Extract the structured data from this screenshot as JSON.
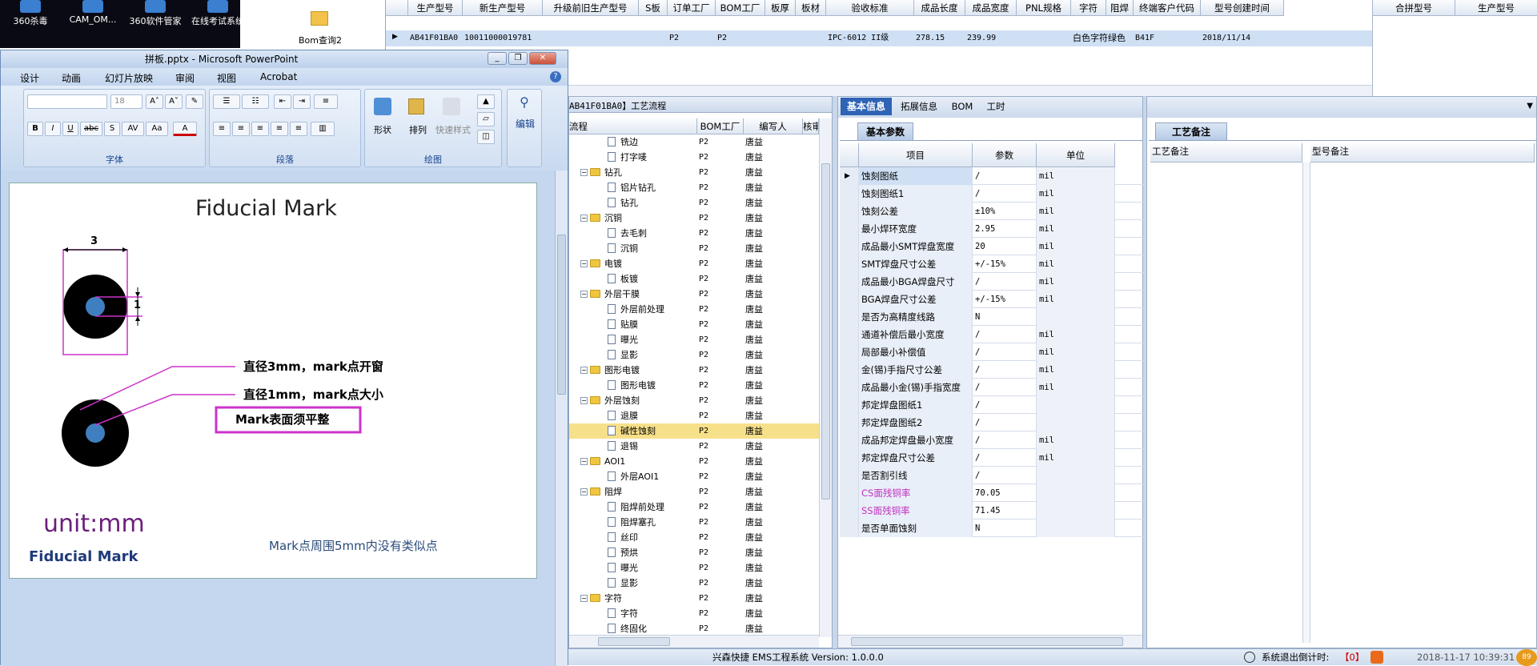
{
  "desktop": {
    "icons": [
      {
        "label": "360杀毒",
        "icon": "antivirus-icon"
      },
      {
        "label": "CAM_OM...",
        "icon": "cam-app-icon"
      },
      {
        "label": "360软件管家",
        "icon": "software-manager-icon"
      },
      {
        "label": "在线考试系统",
        "icon": "exam-system-icon"
      }
    ],
    "folder_label": "Bom查询2"
  },
  "top_grid": {
    "columns": [
      "生产型号",
      "新生产型号",
      "升级前旧生产型号",
      "S板",
      "订单工厂",
      "BOM工厂",
      "板厚",
      "板材",
      "验收标准",
      "成品长度",
      "成品宽度",
      "PNL规格",
      "字符",
      "阻焊",
      "终端客户代码",
      "型号创建时间"
    ],
    "row": [
      "AB41F01BA0",
      "10011000019781",
      "",
      "",
      "P2",
      "P2",
      "",
      "",
      "IPC-6012 II级",
      "278.15",
      "239.99",
      "",
      "白色字符",
      "绿色",
      "B41F",
      "2018/11/14"
    ],
    "right_columns": [
      "合拼型号",
      "生产型号"
    ]
  },
  "ppt": {
    "title": "拼板.pptx - Microsoft PowerPoint",
    "tabs": [
      "设计",
      "动画",
      "幻灯片放映",
      "审阅",
      "视图",
      "Acrobat"
    ],
    "font_size": "18",
    "groups": {
      "font": "字体",
      "paragraph": "段落",
      "drawing": "绘图"
    },
    "drawing_buttons": {
      "shape": "形状",
      "arrange": "排列",
      "quick_style": "快速样式",
      "edit": "编辑"
    },
    "slide": {
      "title": "Fiducial Mark",
      "dim_outer": "3",
      "dim_inner": "1",
      "note1": "直径3mm，mark点开窗",
      "note2": "直径1mm，mark点大小",
      "note3": "Mark表面须平整",
      "unit": "unit:mm",
      "footer_left": "Fiducial Mark",
      "footer_note": "Mark点周围5mm内没有类似点"
    }
  },
  "tree": {
    "header_title": "AB41F01BA0】工艺流程",
    "columns": [
      "流程",
      "BOM工厂",
      "编写人",
      "核审"
    ],
    "rows": [
      {
        "label": "铣边",
        "level": 2,
        "folder": false,
        "factory": "P2",
        "author": "唐益"
      },
      {
        "label": "打字唛",
        "level": 2,
        "folder": false,
        "factory": "P2",
        "author": "唐益"
      },
      {
        "label": "钻孔",
        "level": 1,
        "folder": true,
        "factory": "P2",
        "author": "唐益"
      },
      {
        "label": "铝片钻孔",
        "level": 2,
        "folder": false,
        "factory": "P2",
        "author": "唐益"
      },
      {
        "label": "钻孔",
        "level": 2,
        "folder": false,
        "factory": "P2",
        "author": "唐益"
      },
      {
        "label": "沉铜",
        "level": 1,
        "folder": true,
        "factory": "P2",
        "author": "唐益"
      },
      {
        "label": "去毛刺",
        "level": 2,
        "folder": false,
        "factory": "P2",
        "author": "唐益"
      },
      {
        "label": "沉铜",
        "level": 2,
        "folder": false,
        "factory": "P2",
        "author": "唐益"
      },
      {
        "label": "电镀",
        "level": 1,
        "folder": true,
        "factory": "P2",
        "author": "唐益"
      },
      {
        "label": "板镀",
        "level": 2,
        "folder": false,
        "factory": "P2",
        "author": "唐益"
      },
      {
        "label": "外层干膜",
        "level": 1,
        "folder": true,
        "factory": "P2",
        "author": "唐益"
      },
      {
        "label": "外层前处理",
        "level": 2,
        "folder": false,
        "factory": "P2",
        "author": "唐益"
      },
      {
        "label": "贴膜",
        "level": 2,
        "folder": false,
        "factory": "P2",
        "author": "唐益"
      },
      {
        "label": "曝光",
        "level": 2,
        "folder": false,
        "factory": "P2",
        "author": "唐益"
      },
      {
        "label": "显影",
        "level": 2,
        "folder": false,
        "factory": "P2",
        "author": "唐益"
      },
      {
        "label": "图形电镀",
        "level": 1,
        "folder": true,
        "factory": "P2",
        "author": "唐益"
      },
      {
        "label": "图形电镀",
        "level": 2,
        "folder": false,
        "factory": "P2",
        "author": "唐益"
      },
      {
        "label": "外层蚀刻",
        "level": 1,
        "folder": true,
        "factory": "P2",
        "author": "唐益"
      },
      {
        "label": "退膜",
        "level": 2,
        "folder": false,
        "factory": "P2",
        "author": "唐益"
      },
      {
        "label": "碱性蚀刻",
        "level": 2,
        "folder": false,
        "factory": "P2",
        "author": "唐益",
        "selected": true
      },
      {
        "label": "退锡",
        "level": 2,
        "folder": false,
        "factory": "P2",
        "author": "唐益"
      },
      {
        "label": "AOI1",
        "level": 1,
        "folder": true,
        "factory": "P2",
        "author": "唐益"
      },
      {
        "label": "外层AOI1",
        "level": 2,
        "folder": false,
        "factory": "P2",
        "author": "唐益"
      },
      {
        "label": "阻焊",
        "level": 1,
        "folder": true,
        "factory": "P2",
        "author": "唐益"
      },
      {
        "label": "阻焊前处理",
        "level": 2,
        "folder": false,
        "factory": "P2",
        "author": "唐益"
      },
      {
        "label": "阻焊塞孔",
        "level": 2,
        "folder": false,
        "factory": "P2",
        "author": "唐益"
      },
      {
        "label": "丝印",
        "level": 2,
        "folder": false,
        "factory": "P2",
        "author": "唐益"
      },
      {
        "label": "预烘",
        "level": 2,
        "folder": false,
        "factory": "P2",
        "author": "唐益"
      },
      {
        "label": "曝光",
        "level": 2,
        "folder": false,
        "factory": "P2",
        "author": "唐益"
      },
      {
        "label": "显影",
        "level": 2,
        "folder": false,
        "factory": "P2",
        "author": "唐益"
      },
      {
        "label": "字符",
        "level": 1,
        "folder": true,
        "factory": "P2",
        "author": "唐益"
      },
      {
        "label": "字符",
        "level": 2,
        "folder": false,
        "factory": "P2",
        "author": "唐益"
      },
      {
        "label": "终固化",
        "level": 2,
        "folder": false,
        "factory": "P2",
        "author": "唐益"
      }
    ]
  },
  "props": {
    "tabs": [
      "基本信息",
      "拓展信息",
      "BOM",
      "工时"
    ],
    "sub_tab": "基本参数",
    "columns": [
      "项目",
      "参数",
      "单位"
    ],
    "rows": [
      {
        "item": "蚀刻图纸",
        "value": "/",
        "unit": "mil"
      },
      {
        "item": "蚀刻图纸1",
        "value": "/",
        "unit": "mil"
      },
      {
        "item": "蚀刻公差",
        "value": "±10%",
        "unit": "mil"
      },
      {
        "item": "最小焊环宽度",
        "value": "2.95",
        "unit": "mil"
      },
      {
        "item": "成品最小SMT焊盘宽度",
        "value": "20",
        "unit": "mil"
      },
      {
        "item": "SMT焊盘尺寸公差",
        "value": "+/-15%",
        "unit": "mil"
      },
      {
        "item": "成品最小BGA焊盘尺寸",
        "value": "/",
        "unit": "mil"
      },
      {
        "item": "BGA焊盘尺寸公差",
        "value": "+/-15%",
        "unit": "mil"
      },
      {
        "item": "是否为高精度线路",
        "value": "N",
        "unit": ""
      },
      {
        "item": "通道补偿后最小宽度",
        "value": "/",
        "unit": "mil"
      },
      {
        "item": "局部最小补偿值",
        "value": "/",
        "unit": "mil"
      },
      {
        "item": "金(锡)手指尺寸公差",
        "value": "/",
        "unit": "mil"
      },
      {
        "item": "成品最小金(锡)手指宽度",
        "value": "/",
        "unit": "mil"
      },
      {
        "item": "邦定焊盘图纸1",
        "value": "/",
        "unit": ""
      },
      {
        "item": "邦定焊盘图纸2",
        "value": "/",
        "unit": ""
      },
      {
        "item": "成品邦定焊盘最小宽度",
        "value": "/",
        "unit": "mil"
      },
      {
        "item": "邦定焊盘尺寸公差",
        "value": "/",
        "unit": "mil"
      },
      {
        "item": "是否割引线",
        "value": "/",
        "unit": ""
      },
      {
        "item": "CS面残铜率",
        "value": "70.05",
        "unit": "",
        "highlight": true
      },
      {
        "item": "SS面残铜率",
        "value": "71.45",
        "unit": "",
        "highlight": true
      },
      {
        "item": "是否单面蚀刻",
        "value": "N",
        "unit": ""
      }
    ]
  },
  "notes": {
    "tab": "工艺备注",
    "columns": [
      "工艺备注",
      "型号备注"
    ]
  },
  "status": {
    "system": "兴森快捷 EMS工程系统  Version: 1.0.0.0",
    "countdown_label": "系统退出倒计时:",
    "countdown_value": "【0】",
    "clock": "2018-11-17 10:39:31"
  },
  "colors": {
    "accent": "#cc33cc",
    "selection": "#f7e08a",
    "grid_selected": "#cfe0f5"
  }
}
